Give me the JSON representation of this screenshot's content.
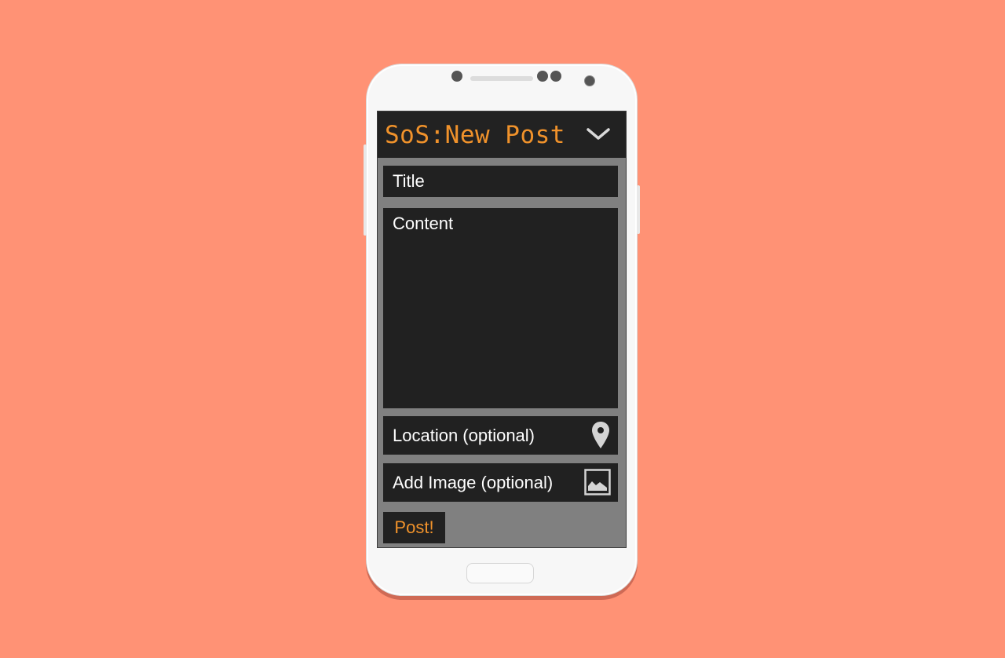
{
  "app": {
    "title": "SoS:New Post"
  },
  "header": {
    "collapse_icon": "chevron-down-icon"
  },
  "form": {
    "title_placeholder": "Title",
    "content_placeholder": "Content",
    "location_placeholder": "Location (optional)",
    "location_icon": "map-pin-icon",
    "image_placeholder": "Add Image (optional)",
    "image_icon": "image-icon",
    "submit_label": "Post!"
  },
  "colors": {
    "background": "#ff9275",
    "accent": "#f0922b",
    "appbar": "#222222",
    "field": "#212121",
    "screen": "#808080"
  }
}
